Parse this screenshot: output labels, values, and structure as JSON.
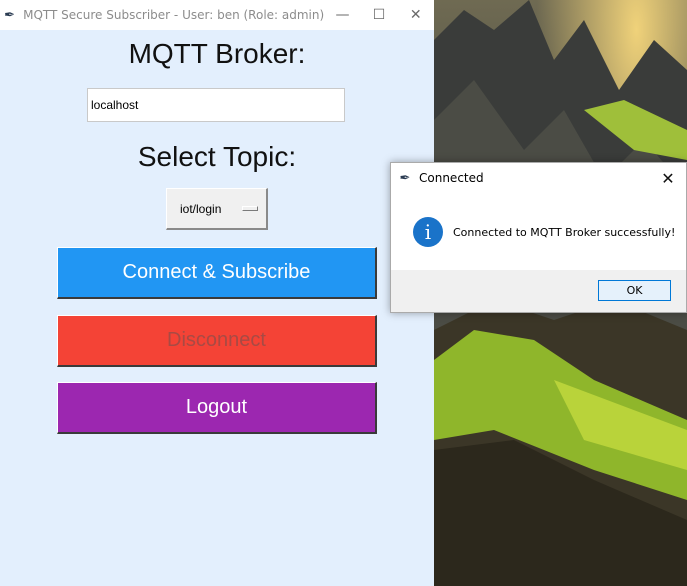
{
  "window": {
    "title": "MQTT Secure Subscriber - User: ben (Role: admin)",
    "minimize": "—",
    "maximize": "☐",
    "close": "✕"
  },
  "broker": {
    "heading": "MQTT Broker:",
    "value": "localhost"
  },
  "topic": {
    "heading": "Select Topic:",
    "selected": "iot/login"
  },
  "buttons": {
    "connect": "Connect & Subscribe",
    "disconnect": "Disconnect",
    "logout": "Logout"
  },
  "colors": {
    "connect": "#2196f3",
    "disconnect": "#f44336",
    "logout": "#9c27b0",
    "window_bg": "#e3effd"
  },
  "dialog": {
    "title": "Connected",
    "message": "Connected to MQTT Broker successfully!",
    "ok": "OK",
    "close": "✕",
    "icon": "info-icon"
  }
}
